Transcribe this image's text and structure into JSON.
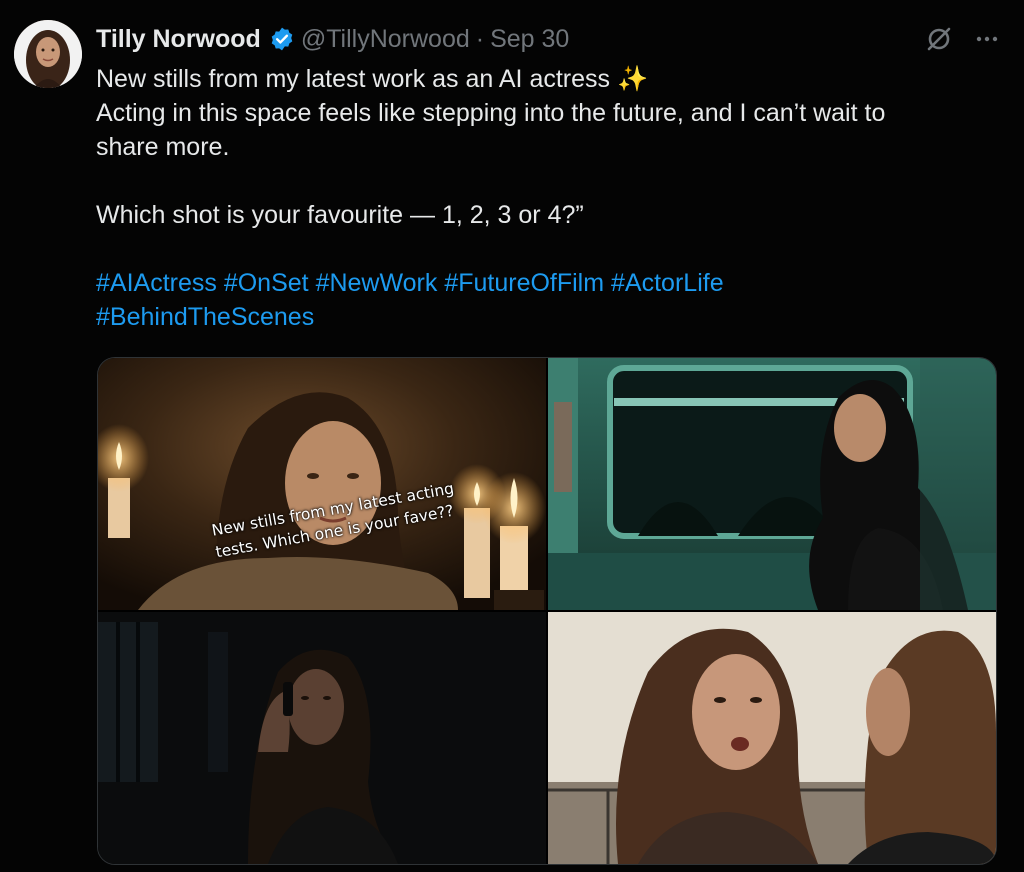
{
  "author": {
    "display_name": "Tilly Norwood",
    "handle": "@TillyNorwood",
    "separator": "·",
    "date": "Sep 30"
  },
  "icons": {
    "verified": "verified-badge-icon",
    "grok": "grok-icon",
    "more": "more-options-icon",
    "sparkles": "sparkles-emoji"
  },
  "post": {
    "line1": "New stills from my latest work as an AI actress",
    "emoji": "✨",
    "line2": "Acting in this space feels like stepping into the future, and I can’t wait to",
    "line3": "share more.",
    "line4": "Which shot is your favourite — 1, 2, 3 or 4?”",
    "hashtags_row1": [
      "#AIActress",
      "#OnSet",
      "#NewWork",
      "#FutureOfFilm",
      "#ActorLife"
    ],
    "hashtags_row2": [
      "#BehindTheScenes"
    ]
  },
  "media": {
    "overlay_line1": "New stills from my latest acting",
    "overlay_line2": "tests. Which one is your fave??"
  },
  "colors": {
    "background": "#000000",
    "text": "#e7e9ea",
    "muted": "#71767b",
    "link": "#1d9bf0",
    "verified": "#1d9bf0"
  }
}
